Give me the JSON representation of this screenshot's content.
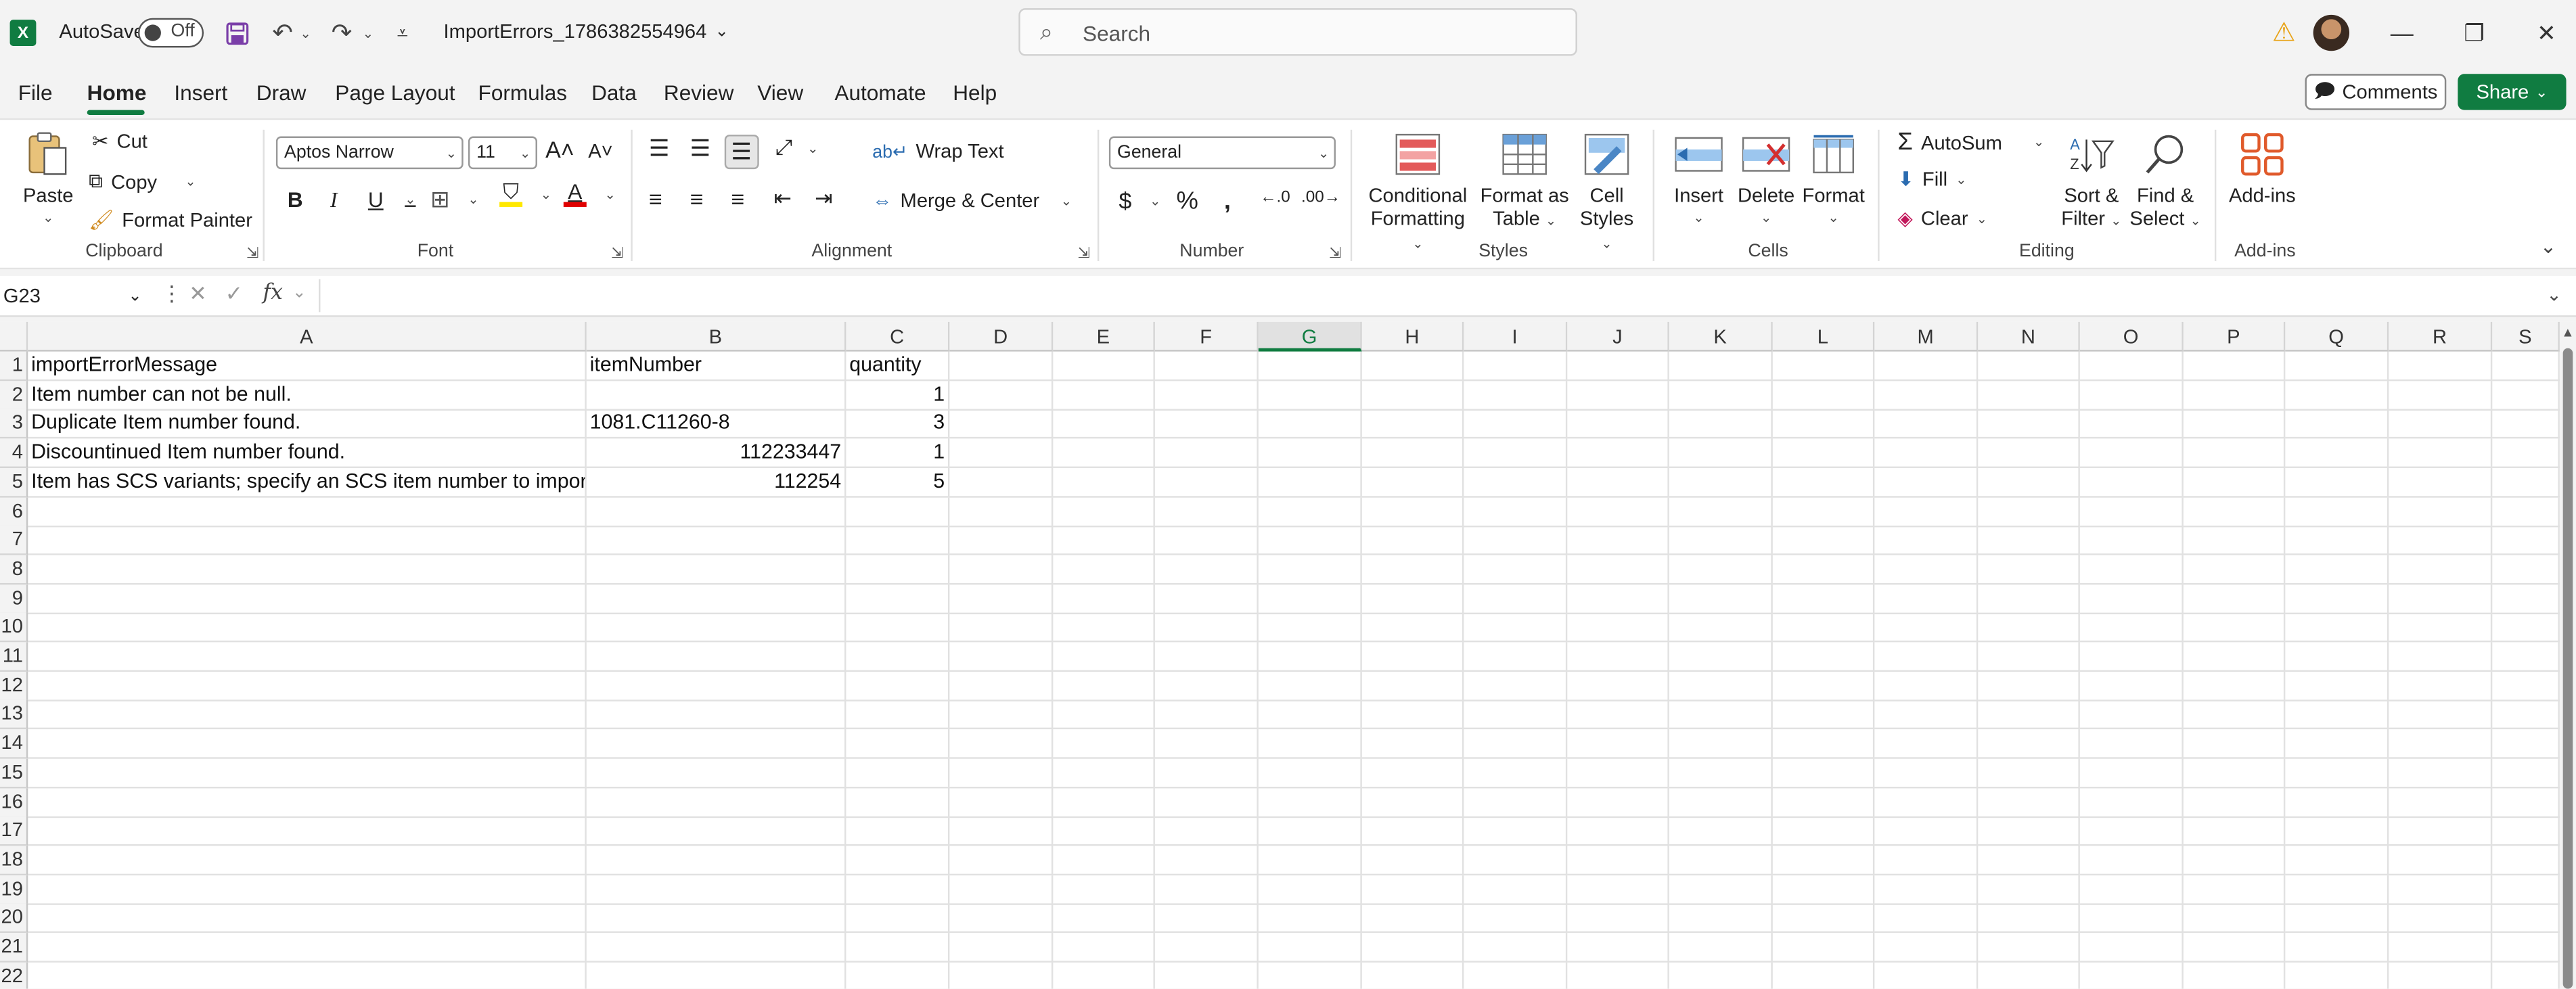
{
  "app": {
    "autosave_label": "AutoSave",
    "autosave_state": "Off",
    "file_name": "ImportErrors_1786382554964",
    "search_placeholder": "Search",
    "brand_color": "#107c41"
  },
  "menu": {
    "tabs": [
      "File",
      "Home",
      "Insert",
      "Draw",
      "Page Layout",
      "Formulas",
      "Data",
      "Review",
      "View",
      "Automate",
      "Help"
    ],
    "active": "Home",
    "comments_label": "Comments",
    "share_label": "Share"
  },
  "ribbon": {
    "clipboard": {
      "label": "Clipboard",
      "paste": "Paste",
      "cut": "Cut",
      "copy": "Copy",
      "format_painter": "Format Painter"
    },
    "font": {
      "label": "Font",
      "family": "Aptos Narrow",
      "size": "11",
      "bold": "B",
      "italic": "I",
      "underline": "U"
    },
    "alignment": {
      "label": "Alignment",
      "wrap_text": "Wrap Text",
      "merge_center": "Merge & Center"
    },
    "number": {
      "label": "Number",
      "format": "General"
    },
    "styles": {
      "label": "Styles",
      "conditional_l1": "Conditional",
      "conditional_l2": "Formatting",
      "format_table_l1": "Format as",
      "format_table_l2": "Table",
      "cell_styles_l1": "Cell",
      "cell_styles_l2": "Styles"
    },
    "cells": {
      "label": "Cells",
      "insert": "Insert",
      "delete": "Delete",
      "format": "Format"
    },
    "editing": {
      "label": "Editing",
      "autosum": "AutoSum",
      "fill": "Fill",
      "clear": "Clear",
      "sort_l1": "Sort &",
      "sort_l2": "Filter",
      "find_l1": "Find &",
      "find_l2": "Select"
    },
    "addins": {
      "label": "Add-ins",
      "addins_btn": "Add-ins"
    }
  },
  "formula_bar": {
    "name_box": "G23",
    "fx": "fx",
    "value": ""
  },
  "sheet": {
    "columns": [
      "A",
      "B",
      "C",
      "D",
      "E",
      "F",
      "G",
      "H",
      "I",
      "J",
      "K",
      "L",
      "M",
      "N",
      "O",
      "P",
      "Q",
      "R",
      "S"
    ],
    "selected_column": "G",
    "rows": [
      [
        "importErrorMessage",
        "itemNumber",
        "quantity"
      ],
      [
        "Item number can not be null.",
        "",
        "1"
      ],
      [
        "Duplicate Item number found.",
        "1081.C11260-8",
        "3"
      ],
      [
        "Discountinued Item number found.",
        "112233447",
        "1"
      ],
      [
        "Item has SCS variants; specify an SCS item number to import.",
        "112254",
        "5"
      ]
    ],
    "row_numbers": [
      "1",
      "2",
      "3",
      "4",
      "5",
      "6",
      "7",
      "8",
      "9",
      "10",
      "11",
      "12",
      "13",
      "14",
      "15",
      "16",
      "17",
      "18",
      "19",
      "20",
      "21",
      "22"
    ]
  }
}
